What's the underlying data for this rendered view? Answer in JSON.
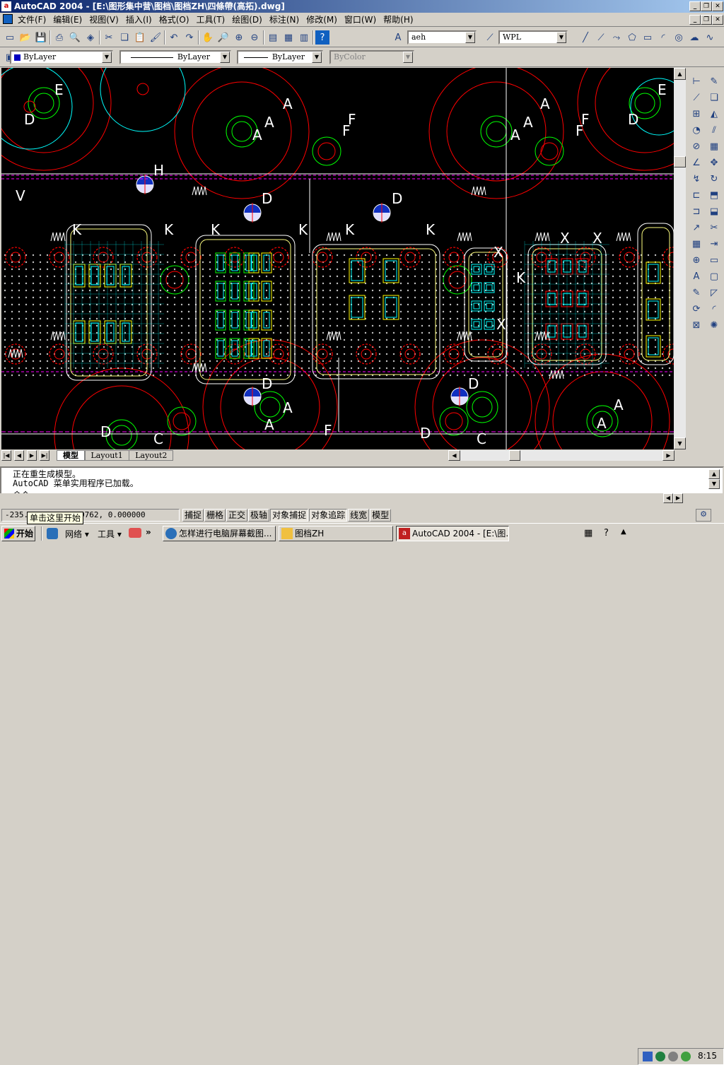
{
  "window": {
    "title": "AutoCAD 2004 - [E:\\图形集中营\\图档\\图档ZH\\四條帶(高拓).dwg]",
    "app_icon": "autocad-icon"
  },
  "menu": [
    "文件(F)",
    "编辑(E)",
    "视图(V)",
    "插入(I)",
    "格式(O)",
    "工具(T)",
    "绘图(D)",
    "标注(N)",
    "修改(M)",
    "窗口(W)",
    "帮助(H)"
  ],
  "toolbar": {
    "textstyle": "aeh",
    "dimstyle": "WPL"
  },
  "props": {
    "color": "ByLayer",
    "linetype": "ByLayer",
    "lineweight": "ByLayer",
    "plotstyle": "ByColor"
  },
  "tabs": [
    "模型",
    "Layout1",
    "Layout2"
  ],
  "command": {
    "lines": [
      "正在重生成模型。",
      "AutoCAD 菜单实用程序已加载。"
    ],
    "prompt": "命令:"
  },
  "status": {
    "coords": "-235.5[unclear]50762, 0.000000",
    "toggles": [
      "捕捉",
      "栅格",
      "正交",
      "极轴",
      "对象捕捉",
      "对象追踪",
      "线宽",
      "模型"
    ],
    "tooltip": "单击这里开始"
  },
  "taskbar": {
    "start": "开始",
    "quick": [
      "网络",
      "工具"
    ],
    "tasks": [
      "怎样进行电脑屏幕截图...",
      "图档ZH",
      "AutoCAD 2004 - [E:\\图..."
    ],
    "time": "8:15"
  },
  "drawing": {
    "labels": [
      "E",
      "D",
      "A",
      "A",
      "A",
      "F",
      "F",
      "H",
      "V",
      "D",
      "D",
      "K",
      "K",
      "K",
      "K",
      "K",
      "K",
      "A",
      "A",
      "D",
      "D",
      "F",
      "C",
      "E",
      "D",
      "A",
      "A",
      "A",
      "F",
      "F",
      "K",
      "X",
      "X",
      "X",
      "X",
      "D",
      "A",
      "A",
      "D",
      "C"
    ]
  },
  "colors": {
    "canvas": "#000000",
    "titlebar": "#0a246a",
    "red": "#ff0000",
    "green": "#00ff00",
    "cyan": "#00ffff",
    "yellow": "#ffff00",
    "white": "#ffffff",
    "magenta": "#ff00ff"
  }
}
